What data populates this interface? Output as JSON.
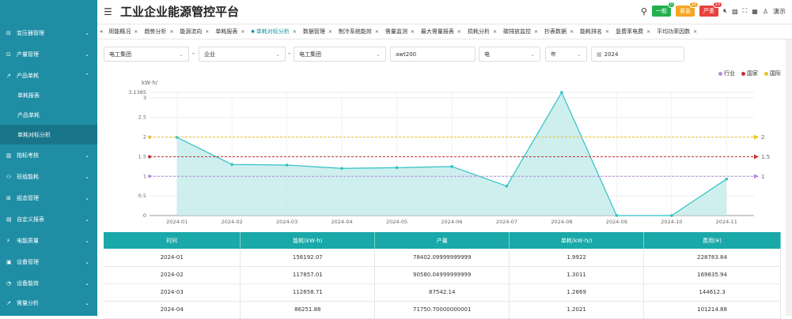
{
  "app": {
    "title": "工业企业能源管控平台"
  },
  "topbar": {
    "badges": [
      {
        "label": "一般",
        "count": "0",
        "color": "#22b14c"
      },
      {
        "label": "紧急",
        "count": "10",
        "color": "#f5a623"
      },
      {
        "label": "严重",
        "count": "23",
        "color": "#e8413c"
      }
    ],
    "user": "演示"
  },
  "sidebar": {
    "items": [
      {
        "label": "变压器管理"
      },
      {
        "label": "产量管理"
      },
      {
        "label": "产品单耗",
        "expanded": true
      },
      {
        "label": "指标考核"
      },
      {
        "label": "班组能耗"
      },
      {
        "label": "组态管理"
      },
      {
        "label": "自定义报表"
      },
      {
        "label": "电能质量"
      },
      {
        "label": "设备管理"
      },
      {
        "label": "设备能效"
      },
      {
        "label": "需量分析"
      }
    ],
    "sub_items": [
      "单耗报表",
      "产品单耗",
      "单耗对标分析"
    ]
  },
  "tabs": [
    "用能概况",
    "趋势分析",
    "能源流向",
    "单耗报表",
    "单耗对标分析",
    "数据管理",
    "制冷系统能效",
    "需量监测",
    "最大需量报表",
    "损耗分析",
    "碳排放监控",
    "抄表数据",
    "能耗排名",
    "复费率电费",
    "平均功率因数"
  ],
  "filters": {
    "f1": "电工集团",
    "f2": "企业",
    "f3": "电工集团",
    "f4": "awt200",
    "f5": "电",
    "f6": "年",
    "f7": "2024"
  },
  "chart_data": {
    "type": "area",
    "ylabel": "kW·h/",
    "ylim": [
      0,
      3.1385
    ],
    "yticks": [
      "0",
      "0.5",
      "1",
      "1.5",
      "2",
      "2.5",
      "3",
      "3.1385"
    ],
    "categories": [
      "2024-01",
      "2024-02",
      "2024-03",
      "2024-04",
      "2024-05",
      "2024-06",
      "2024-07",
      "2024-08",
      "2024-09",
      "2024-10",
      "2024-11"
    ],
    "series": [
      {
        "name": "单耗",
        "values": [
          1.9922,
          1.3011,
          1.2869,
          1.2021,
          1.22,
          1.25,
          0.75,
          3.1385,
          0,
          0,
          0.93
        ],
        "color": "#2fc1c4"
      }
    ],
    "markLines": [
      {
        "name": "行业",
        "value": 1,
        "label": "1",
        "color": "#b38be0"
      },
      {
        "name": "国家",
        "value": 1.5,
        "label": "1.5",
        "color": "#c23531"
      },
      {
        "name": "国际",
        "value": 2,
        "label": "2",
        "color": "#e6c229"
      }
    ],
    "legend": [
      "行业",
      "国家",
      "国际"
    ]
  },
  "table": {
    "headers": [
      "时间",
      "能耗(kW·h)",
      "产量",
      "单耗(kW·h/)",
      "费用(¥)"
    ],
    "rows": [
      [
        "2024-01",
        "156192.07",
        "78402.09999999999",
        "1.9922",
        "228783.84"
      ],
      [
        "2024-02",
        "117857.01",
        "90580.04999999999",
        "1.3011",
        "169835.94"
      ],
      [
        "2024-03",
        "112658.71",
        "87542.14",
        "1.2869",
        "144612.3"
      ],
      [
        "2024-04",
        "86251.88",
        "71750.70000000001",
        "1.2021",
        "101214.88"
      ]
    ]
  }
}
